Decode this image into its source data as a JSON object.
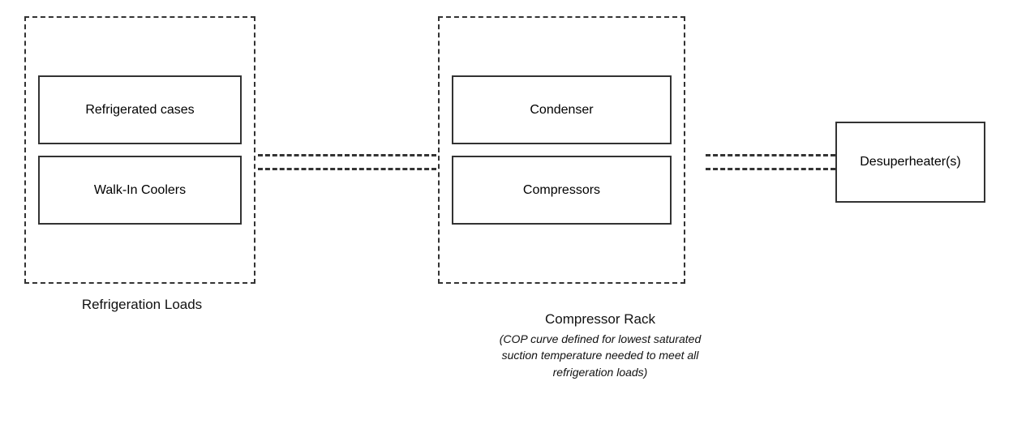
{
  "loads": {
    "outer_label": "Refrigeration Loads",
    "box1_label": "Refrigerated cases",
    "box2_label": "Walk-In Coolers"
  },
  "rack": {
    "outer_label": "Compressor Rack",
    "box1_label": "Condenser",
    "box2_label": "Compressors",
    "caption_line1": "(COP curve defined for lowest saturated",
    "caption_line2": "suction temperature needed to meet all",
    "caption_line3": "refrigeration loads)"
  },
  "desuperheater": {
    "label": "Desuperheater(s)"
  }
}
